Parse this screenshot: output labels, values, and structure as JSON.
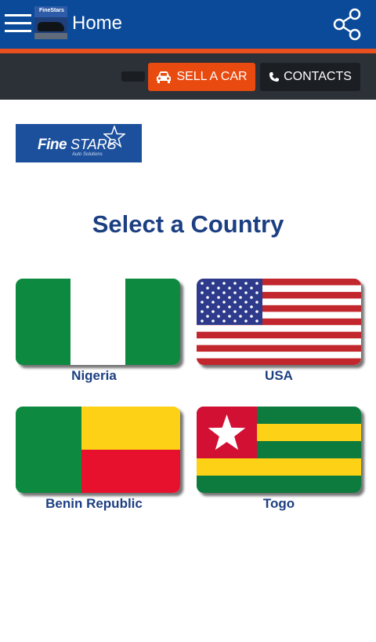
{
  "header": {
    "title": "Home",
    "logo_caption": "FineStars",
    "menu_icon": "hamburger-menu-icon",
    "share_icon": "share-icon",
    "accent_color": "#0b4a98",
    "stripe_color": "#e8501f"
  },
  "toolbar": {
    "sell_label": "SELL A CAR",
    "sell_icon": "car-icon",
    "contacts_label": "CONTACTS",
    "contacts_icon": "phone-icon",
    "sell_color": "#e84a10",
    "bar_color": "#2c3138"
  },
  "brand": {
    "name_main": "Fine",
    "name_stars": "STARS",
    "tagline": "Auto Solutions"
  },
  "main": {
    "heading": "Select a Country",
    "countries": [
      {
        "label": "Nigeria",
        "flag": "nigeria-flag"
      },
      {
        "label": "USA",
        "flag": "usa-flag"
      },
      {
        "label": "Benin Republic",
        "flag": "benin-flag"
      },
      {
        "label": "Togo",
        "flag": "togo-flag"
      }
    ]
  }
}
